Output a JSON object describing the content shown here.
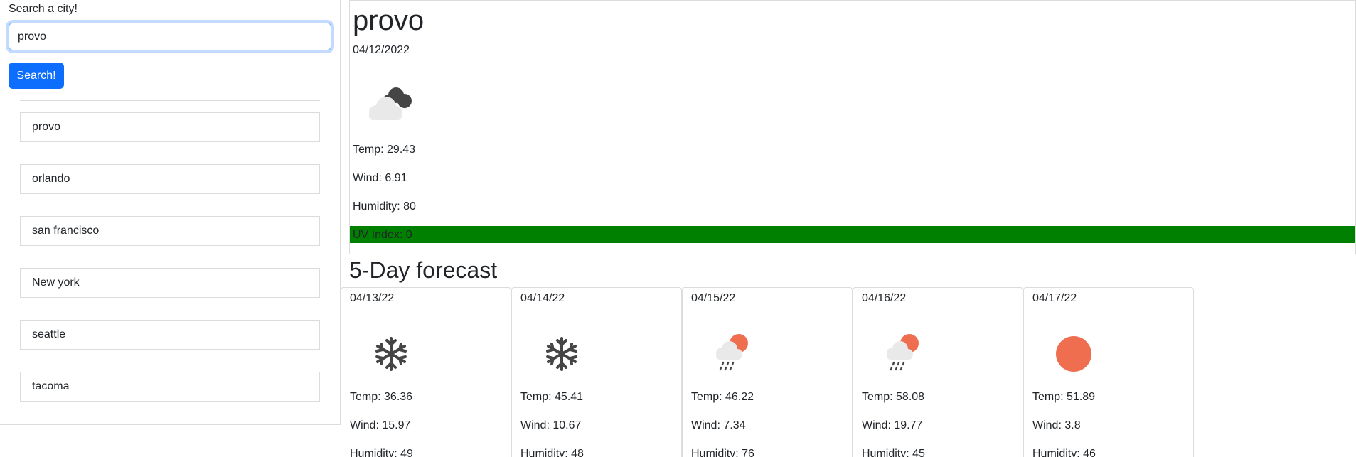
{
  "search": {
    "label": "Search a city!",
    "value": "provo",
    "button_label": "Search!"
  },
  "history": [
    {
      "label": "provo"
    },
    {
      "label": "orlando"
    },
    {
      "label": "san francisco"
    },
    {
      "label": "New york"
    },
    {
      "label": "seattle"
    },
    {
      "label": "tacoma"
    }
  ],
  "current": {
    "city": "provo",
    "date": "04/12/2022",
    "icon": "cloudy-night-icon",
    "temp": "Temp: 29.43",
    "wind": "Wind: 6.91",
    "humidity": "Humidity: 80",
    "uv": "UV Index: 0",
    "uv_color": "#008000"
  },
  "forecast": {
    "title": "5-Day forecast",
    "days": [
      {
        "date": "04/13/22",
        "icon": "snowflake-icon",
        "temp": "Temp: 36.36",
        "wind": "Wind: 15.97",
        "humidity": "Humidity: 49"
      },
      {
        "date": "04/14/22",
        "icon": "snowflake-icon",
        "temp": "Temp: 45.41",
        "wind": "Wind: 10.67",
        "humidity": "Humidity: 48"
      },
      {
        "date": "04/15/22",
        "icon": "sun-rain-icon",
        "temp": "Temp: 46.22",
        "wind": "Wind: 7.34",
        "humidity": "Humidity: 76"
      },
      {
        "date": "04/16/22",
        "icon": "sun-rain-icon",
        "temp": "Temp: 58.08",
        "wind": "Wind: 19.77",
        "humidity": "Humidity: 45"
      },
      {
        "date": "04/17/22",
        "icon": "sun-icon",
        "temp": "Temp: 51.89",
        "wind": "Wind: 3.8",
        "humidity": "Humidity: 46"
      }
    ]
  },
  "colors": {
    "primary": "#0d6efd",
    "sun": "#ee6e4f",
    "cloud": "#e9e9e9",
    "dark_cloud": "#454545"
  }
}
